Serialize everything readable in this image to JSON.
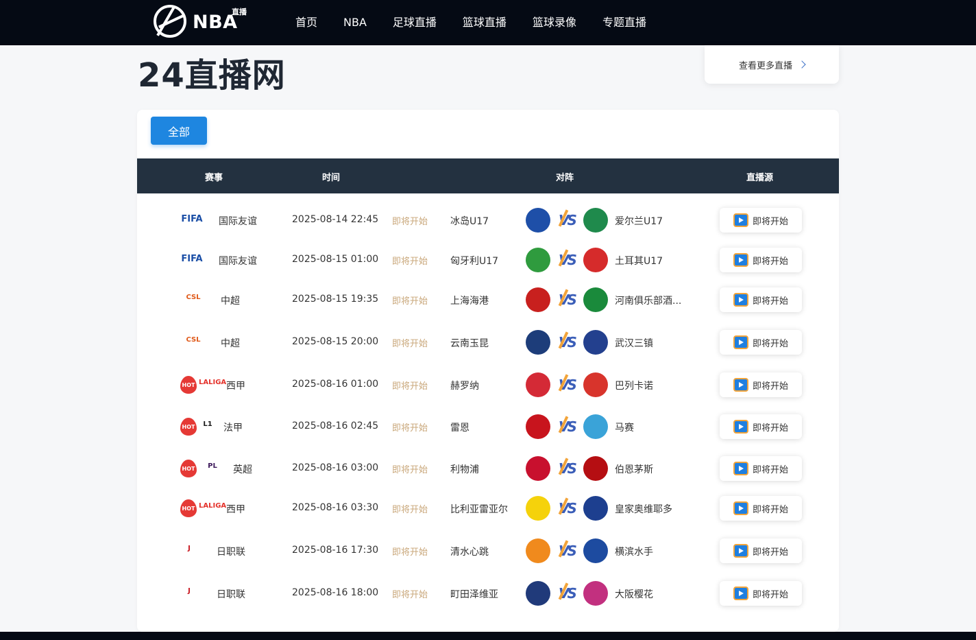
{
  "header": {
    "logo_text": "NBA",
    "logo_sub": "直播",
    "nav": [
      "首页",
      "NBA",
      "足球直播",
      "篮球直播",
      "篮球录像",
      "专题直播"
    ]
  },
  "site_title": "24直播网",
  "more_button": "查看更多直播",
  "tabs": [
    "全部"
  ],
  "table": {
    "headers": [
      "赛事",
      "时间",
      "对阵",
      "直播源"
    ],
    "rows": [
      {
        "league": "国际友谊",
        "logo": "FIFA",
        "hot": false,
        "time": "2025-08-14 22:45",
        "status": "即将开始",
        "home": "冰岛U17",
        "away": "爱尔兰U17",
        "live": "即将开始",
        "home_color": "#1e4fa8",
        "away_color": "#1f8a4c"
      },
      {
        "league": "国际友谊",
        "logo": "FIFA",
        "hot": false,
        "time": "2025-08-15 01:00",
        "status": "即将开始",
        "home": "匈牙利U17",
        "away": "土耳其U17",
        "live": "即将开始",
        "home_color": "#2f9b3e",
        "away_color": "#d62b2b"
      },
      {
        "league": "中超",
        "logo": "CSL",
        "hot": false,
        "time": "2025-08-15 19:35",
        "status": "即将开始",
        "home": "上海海港",
        "away": "河南俱乐部酒...",
        "live": "即将开始",
        "home_color": "#c8201e",
        "away_color": "#1a8a3b"
      },
      {
        "league": "中超",
        "logo": "CSL",
        "hot": false,
        "time": "2025-08-15 20:00",
        "status": "即将开始",
        "home": "云南玉昆",
        "away": "武汉三镇",
        "live": "即将开始",
        "home_color": "#1d3d7a",
        "away_color": "#23408e"
      },
      {
        "league": "西甲",
        "logo": "LALIGA",
        "hot": true,
        "time": "2025-08-16 01:00",
        "status": "即将开始",
        "home": "赫罗纳",
        "away": "巴列卡诺",
        "live": "即将开始",
        "home_color": "#d42a36",
        "away_color": "#d8342c"
      },
      {
        "league": "法甲",
        "logo": "LIGUE1",
        "hot": true,
        "time": "2025-08-16 02:45",
        "status": "即将开始",
        "home": "雷恩",
        "away": "马赛",
        "live": "即将开始",
        "home_color": "#c8141d",
        "away_color": "#3aa3d8"
      },
      {
        "league": "英超",
        "logo": "PL",
        "hot": true,
        "time": "2025-08-16 03:00",
        "status": "即将开始",
        "home": "利物浦",
        "away": "伯恩茅斯",
        "live": "即将开始",
        "home_color": "#c8102e",
        "away_color": "#b50e12"
      },
      {
        "league": "西甲",
        "logo": "LALIGA",
        "hot": true,
        "time": "2025-08-16 03:30",
        "status": "即将开始",
        "home": "比利亚雷亚尔",
        "away": "皇家奥维耶多",
        "live": "即将开始",
        "home_color": "#f5d20b",
        "away_color": "#1d3f8f"
      },
      {
        "league": "日职联",
        "logo": "JL",
        "hot": false,
        "time": "2025-08-16 17:30",
        "status": "即将开始",
        "home": "清水心跳",
        "away": "横滨水手",
        "live": "即将开始",
        "home_color": "#f08a1d",
        "away_color": "#1d4ba0"
      },
      {
        "league": "日职联",
        "logo": "JL",
        "hot": false,
        "time": "2025-08-16 18:00",
        "status": "即将开始",
        "home": "町田泽维亚",
        "away": "大阪樱花",
        "live": "即将开始",
        "home_color": "#203a7a",
        "away_color": "#c2307f"
      }
    ]
  },
  "colors": {
    "accent": "#1e86e0",
    "header_bg": "#050a14",
    "table_head_bg": "#233140",
    "status_gold": "#c9a77a"
  }
}
